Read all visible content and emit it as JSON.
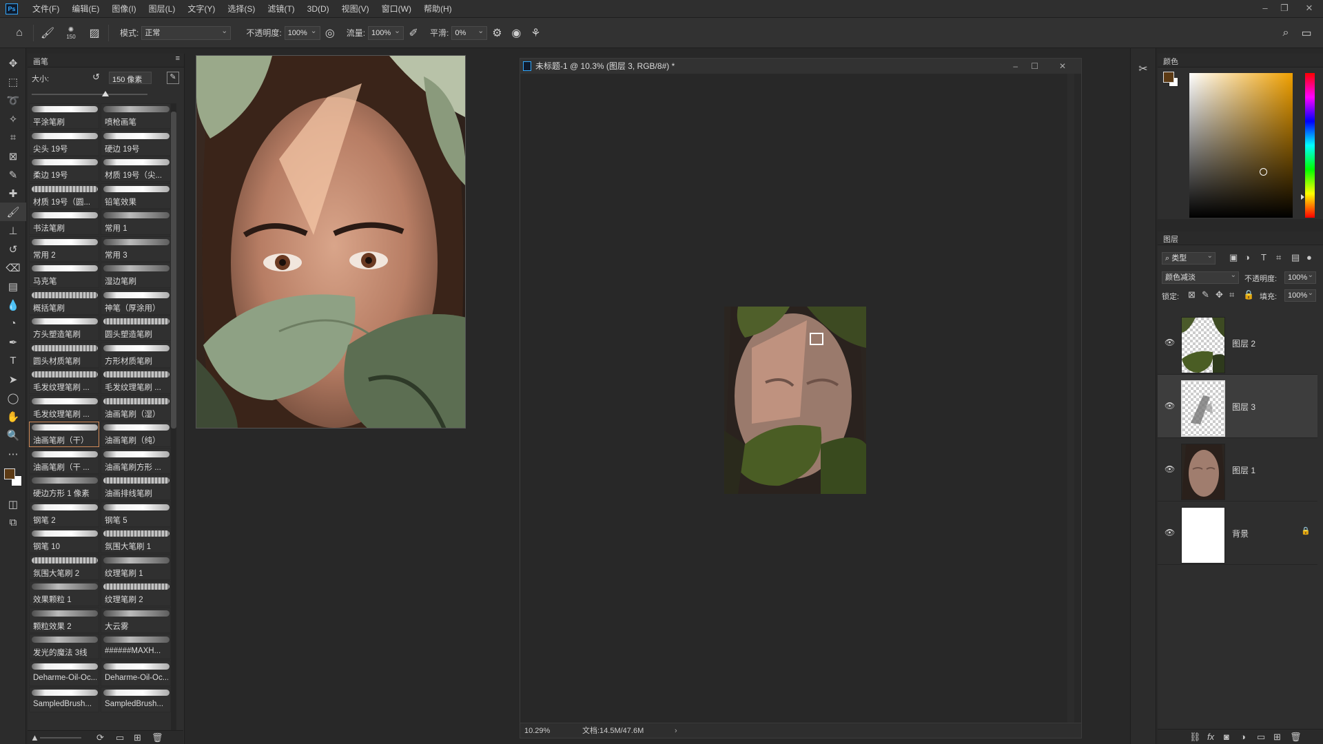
{
  "menubar": {
    "logo": "Ps",
    "items": [
      "文件(F)",
      "编辑(E)",
      "图像(I)",
      "图层(L)",
      "文字(Y)",
      "选择(S)",
      "滤镜(T)",
      "3D(D)",
      "视图(V)",
      "窗口(W)",
      "帮助(H)"
    ]
  },
  "options": {
    "brush_size": "150",
    "mode_label": "模式:",
    "mode_value": "正常",
    "opacity_label": "不透明度:",
    "opacity_value": "100%",
    "flow_label": "流量:",
    "flow_value": "100%",
    "smooth_label": "平滑:",
    "smooth_value": "0%"
  },
  "brush_panel": {
    "title": "画笔",
    "size_label": "大小:",
    "size_value": "150 像素",
    "brushes": [
      {
        "name": "平涂笔刷",
        "stroke": "solid"
      },
      {
        "name": "喷枪画笔",
        "stroke": "soft"
      },
      {
        "name": "尖头 19号",
        "stroke": "solid"
      },
      {
        "name": "硬边 19号",
        "stroke": "solid"
      },
      {
        "name": "柔边 19号",
        "stroke": "solid"
      },
      {
        "name": "材质 19号（尖...",
        "stroke": "solid"
      },
      {
        "name": "材质 19号（圆...",
        "stroke": "rough"
      },
      {
        "name": "铅笔效果",
        "stroke": "solid"
      },
      {
        "name": "书法笔刷",
        "stroke": "solid"
      },
      {
        "name": "常用 1",
        "stroke": "soft"
      },
      {
        "name": "常用 2",
        "stroke": "solid"
      },
      {
        "name": "常用 3",
        "stroke": "soft"
      },
      {
        "name": "马克笔",
        "stroke": "solid"
      },
      {
        "name": "湿边笔刷",
        "stroke": "soft"
      },
      {
        "name": "概括笔刷",
        "stroke": "rough"
      },
      {
        "name": "神笔（厚涂用）",
        "stroke": "solid"
      },
      {
        "name": "方头塑造笔刷",
        "stroke": "solid"
      },
      {
        "name": "圆头塑造笔刷",
        "stroke": "rough"
      },
      {
        "name": "圆头材质笔刷",
        "stroke": "rough"
      },
      {
        "name": "方形材质笔刷",
        "stroke": "solid"
      },
      {
        "name": "毛发纹理笔刷 ...",
        "stroke": "rough"
      },
      {
        "name": "毛发纹理笔刷 ...",
        "stroke": "rough"
      },
      {
        "name": "毛发纹理笔刷 ...",
        "stroke": "solid"
      },
      {
        "name": "油画笔刷（湿）",
        "stroke": "rough"
      },
      {
        "name": "油画笔刷（干）",
        "stroke": "solid",
        "selected": true
      },
      {
        "name": "油画笔刷（纯）",
        "stroke": "solid"
      },
      {
        "name": "油画笔刷（干 ...",
        "stroke": "solid"
      },
      {
        "name": "油画笔刷方形 ...",
        "stroke": "solid"
      },
      {
        "name": "硬边方形 1 像素",
        "stroke": "soft"
      },
      {
        "name": "油画排线笔刷",
        "stroke": "rough"
      },
      {
        "name": "钢笔 2",
        "stroke": "solid"
      },
      {
        "name": "钢笔 5",
        "stroke": "solid"
      },
      {
        "name": "钢笔 10",
        "stroke": "solid"
      },
      {
        "name": "氛围大笔刷 1",
        "stroke": "rough"
      },
      {
        "name": "氛围大笔刷 2",
        "stroke": "rough"
      },
      {
        "name": "纹理笔刷 1",
        "stroke": "soft"
      },
      {
        "name": "效果颗粒 1",
        "stroke": "soft"
      },
      {
        "name": "纹理笔刷 2",
        "stroke": "rough"
      },
      {
        "name": "颗粒效果 2",
        "stroke": "soft"
      },
      {
        "name": "大云雾",
        "stroke": "soft"
      },
      {
        "name": "发光的魔法 3线",
        "stroke": "soft"
      },
      {
        "name": "######MAXH...",
        "stroke": "soft"
      },
      {
        "name": "Deharme-Oil-Oc...",
        "stroke": "solid"
      },
      {
        "name": "Deharme-Oil-Oc...",
        "stroke": "solid"
      },
      {
        "name": "SampledBrush...",
        "stroke": "solid"
      },
      {
        "name": "SampledBrush...",
        "stroke": "solid"
      }
    ]
  },
  "document": {
    "title": "未标题-1 @ 10.3% (图层 3, RGB/8#) *",
    "zoom": "10.29%",
    "doc_info": "文档:14.5M/47.6M"
  },
  "color_panel": {
    "title": "颜色",
    "foreground": "#5c3a14",
    "background": "#ffffff"
  },
  "layers_panel": {
    "title": "图层",
    "filter_kind": "类型",
    "blend_mode": "颜色减淡",
    "opacity_label": "不透明度:",
    "opacity_value": "100%",
    "lock_label": "锁定:",
    "fill_label": "填充:",
    "fill_value": "100%",
    "layers": [
      {
        "name": "图层 2",
        "active": false
      },
      {
        "name": "图层 3",
        "active": true
      },
      {
        "name": "图层 1",
        "active": false
      },
      {
        "name": "背景",
        "active": false,
        "locked": true
      }
    ]
  }
}
